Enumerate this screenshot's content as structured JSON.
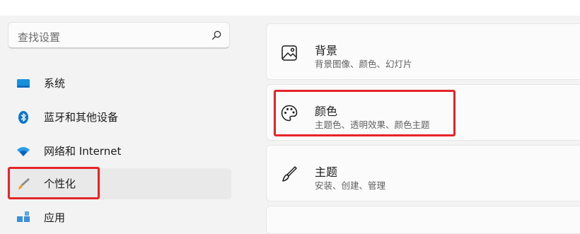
{
  "search": {
    "placeholder": "查找设置"
  },
  "sidebar": {
    "items": [
      {
        "label": "系统",
        "icon": "monitor-icon"
      },
      {
        "label": "蓝牙和其他设备",
        "icon": "bluetooth-icon"
      },
      {
        "label": "网络和 Internet",
        "icon": "wifi-icon"
      },
      {
        "label": "个性化",
        "icon": "brush-icon",
        "selected": true
      },
      {
        "label": "应用",
        "icon": "apps-icon"
      }
    ]
  },
  "cards": [
    {
      "title": "背景",
      "subtitle": "背景图像、颜色、幻灯片",
      "icon": "image-icon"
    },
    {
      "title": "颜色",
      "subtitle": "主题色、透明效果、颜色主题",
      "icon": "palette-icon"
    },
    {
      "title": "主题",
      "subtitle": "安装、创建、管理",
      "icon": "brush-icon"
    }
  ],
  "colors": {
    "highlight": "#e4262b",
    "accent": "#0078d4"
  }
}
